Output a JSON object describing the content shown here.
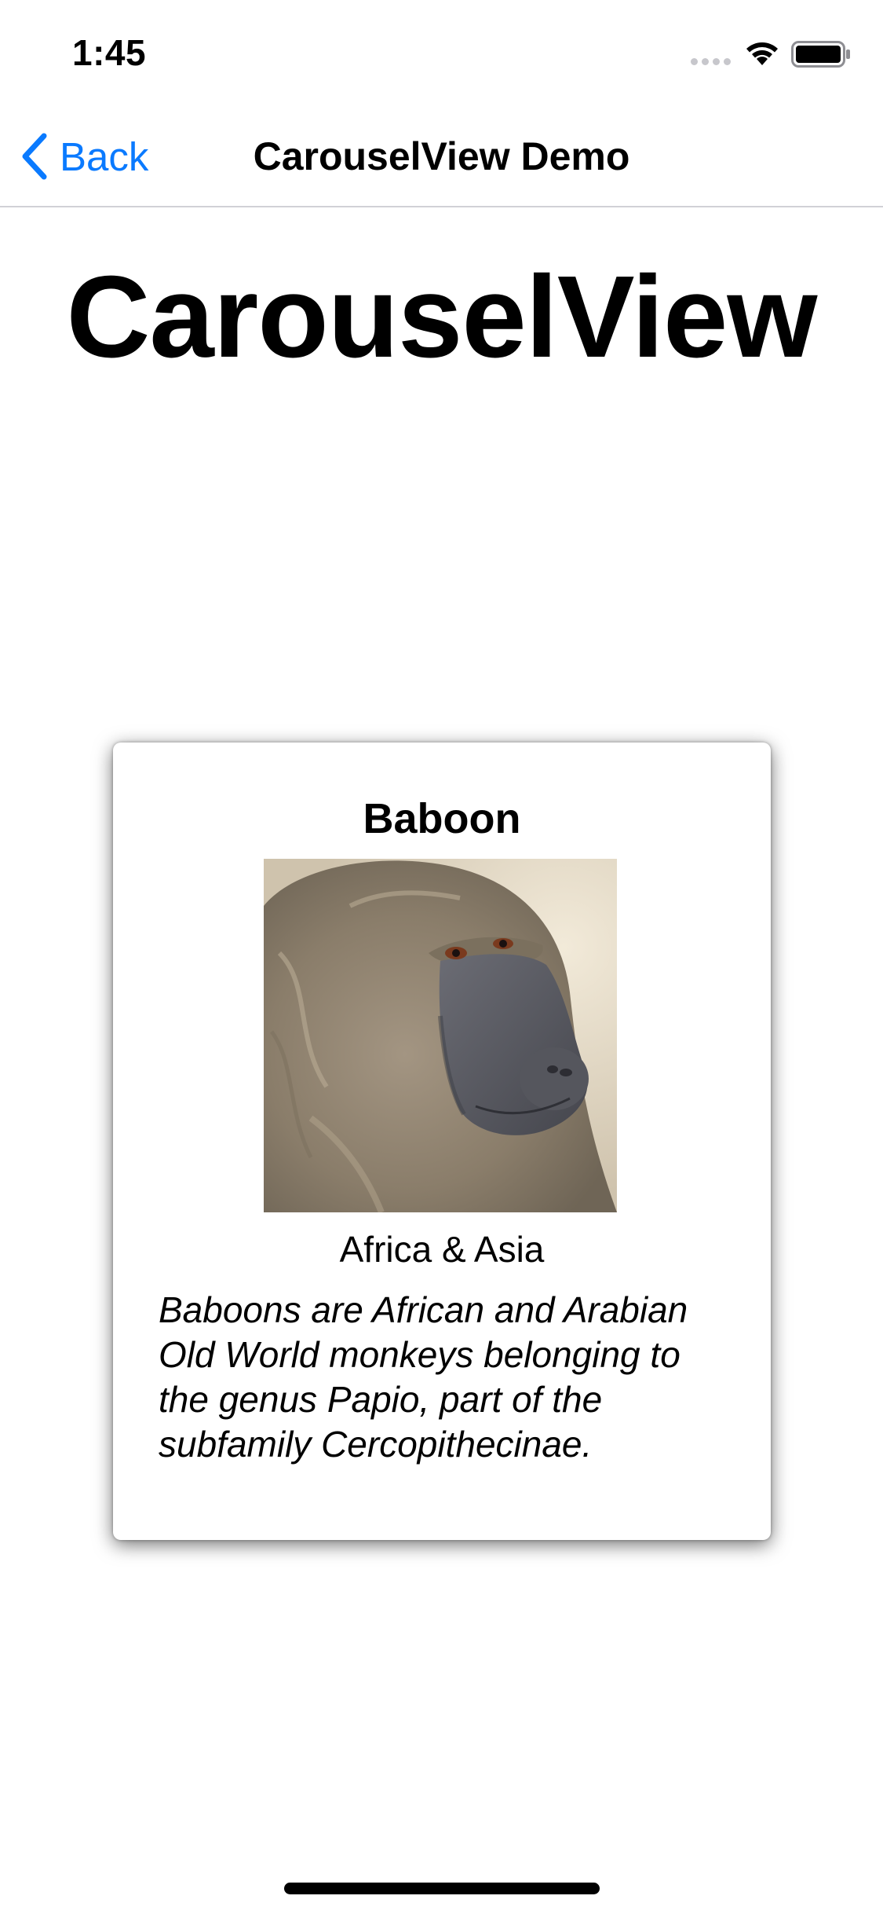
{
  "status_bar": {
    "time": "1:45",
    "icons": [
      "signal-dots-icon",
      "wifi-icon",
      "battery-icon"
    ]
  },
  "nav_bar": {
    "back_label": "Back",
    "title": "CarouselView Demo",
    "accent_color": "#0a7aff"
  },
  "page": {
    "heading": "CarouselView"
  },
  "carousel": {
    "items": [
      {
        "name": "Baboon",
        "image": "baboon-photo",
        "location": "Africa & Asia",
        "details": "Baboons are African and Arabian Old World monkeys belonging to the genus Papio, part of the subfamily Cercopithecinae."
      }
    ]
  }
}
